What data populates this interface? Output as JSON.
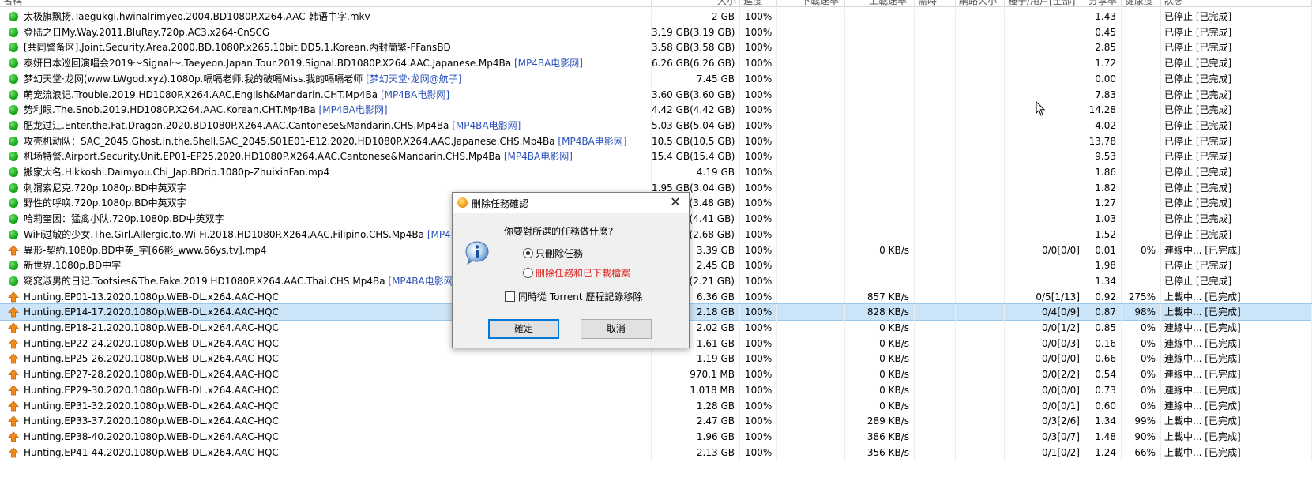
{
  "columns": {
    "name": "名稱",
    "size": "大小",
    "progress": "進度",
    "down_speed": "下載速率",
    "up_speed": "上載速率",
    "eta": "需時",
    "downloaded": "網路大小",
    "peers": "種子/用戶[全部]",
    "ratio": "分享率",
    "availability": "健康度",
    "status": "狀態"
  },
  "rows": [
    {
      "icon": "green-dot",
      "name": "太极旗飘扬.Taegukgi.hwinalrimyeo.2004.BD1080P.X264.AAC-韩语中字.mkv",
      "tag": "",
      "size": "2 GB",
      "progress": "100%",
      "up": "",
      "peers": "",
      "ratio": "1.43",
      "avail": "",
      "status": "已停止 [已完成]"
    },
    {
      "icon": "green-dot",
      "name": "登陆之日My.Way.2011.BluRay.720p.AC3.x264-CnSCG",
      "tag": "",
      "size": "3.19 GB(3.19 GB)",
      "progress": "100%",
      "up": "",
      "peers": "",
      "ratio": "0.45",
      "avail": "",
      "status": "已停止 [已完成]"
    },
    {
      "icon": "green-dot",
      "name": "[共同警备区].Joint.Security.Area.2000.BD.1080P.x265.10bit.DD5.1.Korean.內封簡繁-FFansBD",
      "tag": "",
      "size": "3.58 GB(3.58 GB)",
      "progress": "100%",
      "up": "",
      "peers": "",
      "ratio": "2.85",
      "avail": "",
      "status": "已停止 [已完成]"
    },
    {
      "icon": "green-dot",
      "name": "泰妍日本巡回演唱会2019～Signal～.Taeyeon.Japan.Tour.2019.Signal.BD1080P.X264.AAC.Japanese.Mp4Ba",
      "tag": "[MP4BA电影网]",
      "size": "6.26 GB(6.26 GB)",
      "progress": "100%",
      "up": "",
      "peers": "",
      "ratio": "1.72",
      "avail": "",
      "status": "已停止 [已完成]"
    },
    {
      "icon": "green-dot",
      "name": "梦幻天堂·龙网(www.LWgod.xyz).1080p.嗝嗝老师.我的破嗝Miss.我的嗝嗝老师",
      "tag": "[梦幻天堂·龙网@航子]",
      "size": "7.45 GB",
      "progress": "100%",
      "up": "",
      "peers": "",
      "ratio": "0.00",
      "avail": "",
      "status": "已停止 [已完成]"
    },
    {
      "icon": "green-dot",
      "name": "萌宠流浪记.Trouble.2019.HD1080P.X264.AAC.English&Mandarin.CHT.Mp4Ba",
      "tag": "[MP4BA电影网]",
      "size": "3.60 GB(3.60 GB)",
      "progress": "100%",
      "up": "",
      "peers": "",
      "ratio": "7.83",
      "avail": "",
      "status": "已停止 [已完成]"
    },
    {
      "icon": "green-dot",
      "name": "势利眼.The.Snob.2019.HD1080P.X264.AAC.Korean.CHT.Mp4Ba",
      "tag": "[MP4BA电影网]",
      "size": "4.42 GB(4.42 GB)",
      "progress": "100%",
      "up": "",
      "peers": "",
      "ratio": "14.28",
      "avail": "",
      "status": "已停止 [已完成]"
    },
    {
      "icon": "green-dot",
      "name": "肥龙过江.Enter.the.Fat.Dragon.2020.BD1080P.X264.AAC.Cantonese&Mandarin.CHS.Mp4Ba",
      "tag": "[MP4BA电影网]",
      "size": "5.03 GB(5.04 GB)",
      "progress": "100%",
      "up": "",
      "peers": "",
      "ratio": "4.02",
      "avail": "",
      "status": "已停止 [已完成]"
    },
    {
      "icon": "green-dot",
      "name": "攻壳机动队：SAC_2045.Ghost.in.the.Shell.SAC_2045.S01E01-E12.2020.HD1080P.X264.AAC.Japanese.CHS.Mp4Ba",
      "tag": "[MP4BA电影网]",
      "size": "10.5 GB(10.5 GB)",
      "progress": "100%",
      "up": "",
      "peers": "",
      "ratio": "13.78",
      "avail": "",
      "status": "已停止 [已完成]"
    },
    {
      "icon": "green-dot",
      "name": "机场特警.Airport.Security.Unit.EP01-EP25.2020.HD1080P.X264.AAC.Cantonese&Mandarin.CHS.Mp4Ba",
      "tag": "[MP4BA电影网]",
      "size": "15.4 GB(15.4 GB)",
      "progress": "100%",
      "up": "",
      "peers": "",
      "ratio": "9.53",
      "avail": "",
      "status": "已停止 [已完成]"
    },
    {
      "icon": "green-dot",
      "name": "搬家大名.Hikkoshi.Daimyou.Chi_Jap.BDrip.1080p-ZhuixinFan.mp4",
      "tag": "",
      "size": "4.19 GB",
      "progress": "100%",
      "up": "",
      "peers": "",
      "ratio": "1.86",
      "avail": "",
      "status": "已停止 [已完成]"
    },
    {
      "icon": "green-dot",
      "name": "刺猬索尼克.720p.1080p.BD中英双字",
      "tag": "",
      "size": "1.95 GB(3.04 GB)",
      "progress": "100%",
      "up": "",
      "peers": "",
      "ratio": "1.82",
      "avail": "",
      "status": "已停止 [已完成]"
    },
    {
      "icon": "green-dot",
      "name": "野性的呼唤.720p.1080p.BD中英双字",
      "tag": "",
      "size": "B(3.48 GB)",
      "progress": "100%",
      "up": "",
      "peers": "",
      "ratio": "1.27",
      "avail": "",
      "status": "已停止 [已完成]"
    },
    {
      "icon": "green-dot",
      "name": "哈莉奎因：猛禽小队.720p.1080p.BD中英双字",
      "tag": "",
      "size": "B(4.41 GB)",
      "progress": "100%",
      "up": "",
      "peers": "",
      "ratio": "1.03",
      "avail": "",
      "status": "已停止 [已完成]"
    },
    {
      "icon": "green-dot",
      "name": "WiFi过敏的少女.The.Girl.Allergic.to.Wi-Fi.2018.HD1080P.X264.AAC.Filipino.CHS.Mp4Ba",
      "tag": "[MP4BA",
      "size": "B(2.68 GB)",
      "progress": "100%",
      "up": "",
      "peers": "",
      "ratio": "1.52",
      "avail": "",
      "status": "已停止 [已完成]"
    },
    {
      "icon": "up-arrow",
      "name": "異形-契約.1080p.BD中英_字[66影_www.66ys.tv].mp4",
      "tag": "",
      "size": "3.39 GB",
      "progress": "100%",
      "up": "0 KB/s",
      "peers": "0/0[0/0]",
      "ratio": "0.01",
      "avail": "0%",
      "status": "連線中... [已完成]"
    },
    {
      "icon": "green-dot",
      "name": "新世界.1080p.BD中字",
      "tag": "",
      "size": "2.45 GB",
      "progress": "100%",
      "up": "",
      "peers": "",
      "ratio": "1.98",
      "avail": "",
      "status": "已停止 [已完成]"
    },
    {
      "icon": "green-dot",
      "name": "窈窕淑男的日记.Tootsies&The.Fake.2019.HD1080P.X264.AAC.Thai.CHS.Mp4Ba",
      "tag": "[MP4BA电影网]",
      "size": "B(2.21 GB)",
      "progress": "100%",
      "up": "",
      "peers": "",
      "ratio": "1.34",
      "avail": "",
      "status": "已停止 [已完成]"
    },
    {
      "icon": "up-arrow",
      "name": "Hunting.EP01-13.2020.1080p.WEB-DL.x264.AAC-HQC",
      "tag": "",
      "size": "6.36 GB",
      "progress": "100%",
      "up": "857 KB/s",
      "peers": "0/5[1/13]",
      "ratio": "0.92",
      "avail": "275%",
      "status": "上載中... [已完成]"
    },
    {
      "icon": "up-arrow",
      "name": "Hunting.EP14-17.2020.1080p.WEB-DL.x264.AAC-HQC",
      "tag": "",
      "size": "2.18 GB",
      "progress": "100%",
      "up": "828 KB/s",
      "peers": "0/4[0/9]",
      "ratio": "0.87",
      "avail": "98%",
      "status": "上載中... [已完成]",
      "selected": true
    },
    {
      "icon": "up-arrow",
      "name": "Hunting.EP18-21.2020.1080p.WEB-DL.x264.AAC-HQC",
      "tag": "",
      "size": "2.02 GB",
      "progress": "100%",
      "up": "0 KB/s",
      "peers": "0/0[1/2]",
      "ratio": "0.85",
      "avail": "0%",
      "status": "連線中... [已完成]"
    },
    {
      "icon": "up-arrow",
      "name": "Hunting.EP22-24.2020.1080p.WEB-DL.x264.AAC-HQC",
      "tag": "",
      "size": "1.61 GB",
      "progress": "100%",
      "up": "0 KB/s",
      "peers": "0/0[0/3]",
      "ratio": "0.16",
      "avail": "0%",
      "status": "連線中... [已完成]"
    },
    {
      "icon": "up-arrow",
      "name": "Hunting.EP25-26.2020.1080p.WEB-DL.x264.AAC-HQC",
      "tag": "",
      "size": "1.19 GB",
      "progress": "100%",
      "up": "0 KB/s",
      "peers": "0/0[0/0]",
      "ratio": "0.66",
      "avail": "0%",
      "status": "連線中... [已完成]"
    },
    {
      "icon": "up-arrow",
      "name": "Hunting.EP27-28.2020.1080p.WEB-DL.x264.AAC-HQC",
      "tag": "",
      "size": "970.1 MB",
      "progress": "100%",
      "up": "0 KB/s",
      "peers": "0/0[2/2]",
      "ratio": "0.54",
      "avail": "0%",
      "status": "連線中... [已完成]"
    },
    {
      "icon": "up-arrow",
      "name": "Hunting.EP29-30.2020.1080p.WEB-DL.x264.AAC-HQC",
      "tag": "",
      "size": "1,018 MB",
      "progress": "100%",
      "up": "0 KB/s",
      "peers": "0/0[0/0]",
      "ratio": "0.73",
      "avail": "0%",
      "status": "連線中... [已完成]"
    },
    {
      "icon": "up-arrow",
      "name": "Hunting.EP31-32.2020.1080p.WEB-DL.x264.AAC-HQC",
      "tag": "",
      "size": "1.28 GB",
      "progress": "100%",
      "up": "0 KB/s",
      "peers": "0/0[0/1]",
      "ratio": "0.60",
      "avail": "0%",
      "status": "連線中... [已完成]"
    },
    {
      "icon": "up-arrow",
      "name": "Hunting.EP33-37.2020.1080p.WEB-DL.x264.AAC-HQC",
      "tag": "",
      "size": "2.47 GB",
      "progress": "100%",
      "up": "289 KB/s",
      "peers": "0/3[2/6]",
      "ratio": "1.34",
      "avail": "99%",
      "status": "上載中... [已完成]"
    },
    {
      "icon": "up-arrow",
      "name": "Hunting.EP38-40.2020.1080p.WEB-DL.x264.AAC-HQC",
      "tag": "",
      "size": "1.96 GB",
      "progress": "100%",
      "up": "386 KB/s",
      "peers": "0/3[0/7]",
      "ratio": "1.48",
      "avail": "90%",
      "status": "上載中... [已完成]"
    },
    {
      "icon": "up-arrow",
      "name": "Hunting.EP41-44.2020.1080p.WEB-DL.x264.AAC-HQC",
      "tag": "",
      "size": "2.13 GB",
      "progress": "100%",
      "up": "356 KB/s",
      "peers": "0/1[0/2]",
      "ratio": "1.24",
      "avail": "66%",
      "status": "上載中... [已完成]"
    }
  ],
  "dialog": {
    "title": "刪除任務確認",
    "close": "✕",
    "question": "你要對所選的任務做什麼?",
    "option_task_only": "只刪除任務",
    "option_task_and_files": "刪除任務和已下載檔案",
    "option_task_and_files_color": "#e0201b",
    "checkbox_label": "同時從 Torrent 歷程記錄移除",
    "ok": "確定",
    "cancel": "取消"
  },
  "colors": {
    "selection": "#cce4f7",
    "tag": "#2a52be",
    "default_button_border": "#0078d7"
  }
}
